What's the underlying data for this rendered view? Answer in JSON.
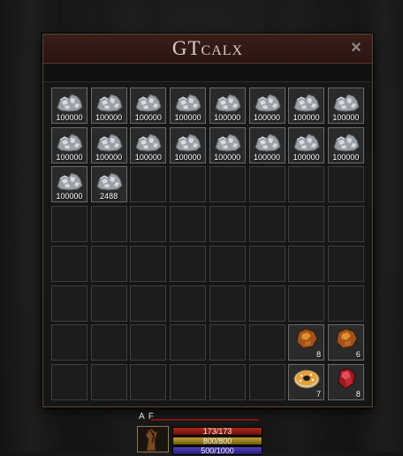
{
  "window": {
    "title": "GTcalx",
    "close_label": "×"
  },
  "grid": {
    "rows": 8,
    "cols": 8,
    "items": [
      {
        "slot": 0,
        "type": "ore",
        "qty": "100000"
      },
      {
        "slot": 1,
        "type": "ore",
        "qty": "100000"
      },
      {
        "slot": 2,
        "type": "ore",
        "qty": "100000"
      },
      {
        "slot": 3,
        "type": "ore",
        "qty": "100000"
      },
      {
        "slot": 4,
        "type": "ore",
        "qty": "100000"
      },
      {
        "slot": 5,
        "type": "ore",
        "qty": "100000"
      },
      {
        "slot": 6,
        "type": "ore",
        "qty": "100000"
      },
      {
        "slot": 7,
        "type": "ore",
        "qty": "100000"
      },
      {
        "slot": 8,
        "type": "ore",
        "qty": "100000"
      },
      {
        "slot": 9,
        "type": "ore",
        "qty": "100000"
      },
      {
        "slot": 10,
        "type": "ore",
        "qty": "100000"
      },
      {
        "slot": 11,
        "type": "ore",
        "qty": "100000"
      },
      {
        "slot": 12,
        "type": "ore",
        "qty": "100000"
      },
      {
        "slot": 13,
        "type": "ore",
        "qty": "100000"
      },
      {
        "slot": 14,
        "type": "ore",
        "qty": "100000"
      },
      {
        "slot": 15,
        "type": "ore",
        "qty": "100000"
      },
      {
        "slot": 16,
        "type": "ore",
        "qty": "100000"
      },
      {
        "slot": 17,
        "type": "ore",
        "qty": "2488"
      },
      {
        "slot": 54,
        "type": "amber-gem",
        "qty": "8"
      },
      {
        "slot": 55,
        "type": "amber-gem",
        "qty": "6"
      },
      {
        "slot": 62,
        "type": "donut",
        "qty": "7"
      },
      {
        "slot": 63,
        "type": "red-gem",
        "qty": "8"
      }
    ]
  },
  "hud": {
    "name": "A F",
    "hp": "173/173",
    "stamina": "800/800",
    "mana": "500/1000",
    "hp_color": "#b02818",
    "stamina_color": "#c0a030",
    "mana_color": "#5040c0"
  }
}
